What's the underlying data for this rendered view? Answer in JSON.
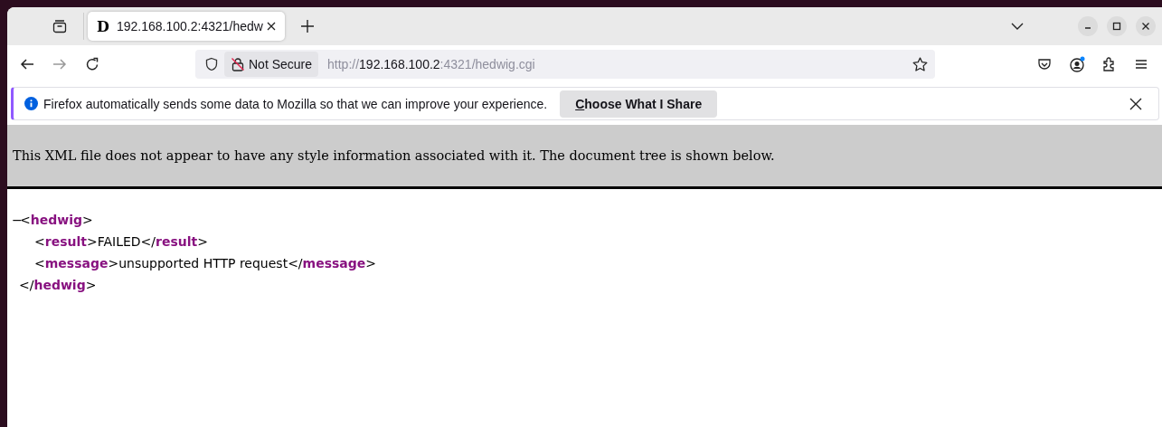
{
  "tabs": [
    {
      "favicon_letter": "D",
      "title": "192.168.100.2:4321/hedw",
      "selected": true
    }
  ],
  "address_bar": {
    "security_label": "Not Secure",
    "url_scheme": "http://",
    "url_host": "192.168.100.2",
    "url_path": ":4321/hedwig.cgi"
  },
  "notification": {
    "message": "Firefox automatically sends some data to Mozilla so that we can improve your experience.",
    "button": "Choose What I Share"
  },
  "xml_banner": "This XML file does not appear to have any style information associated with it. The document tree is shown below.",
  "xml_tree": {
    "toggle": "−",
    "open_tag": "<**hedwig**>",
    "children": [
      {
        "line": "<**result**>FAILED</**result**>"
      },
      {
        "line": "<**message**>unsupported HTTP request</**message**>"
      }
    ],
    "close_tag": "</**hedwig**>"
  }
}
